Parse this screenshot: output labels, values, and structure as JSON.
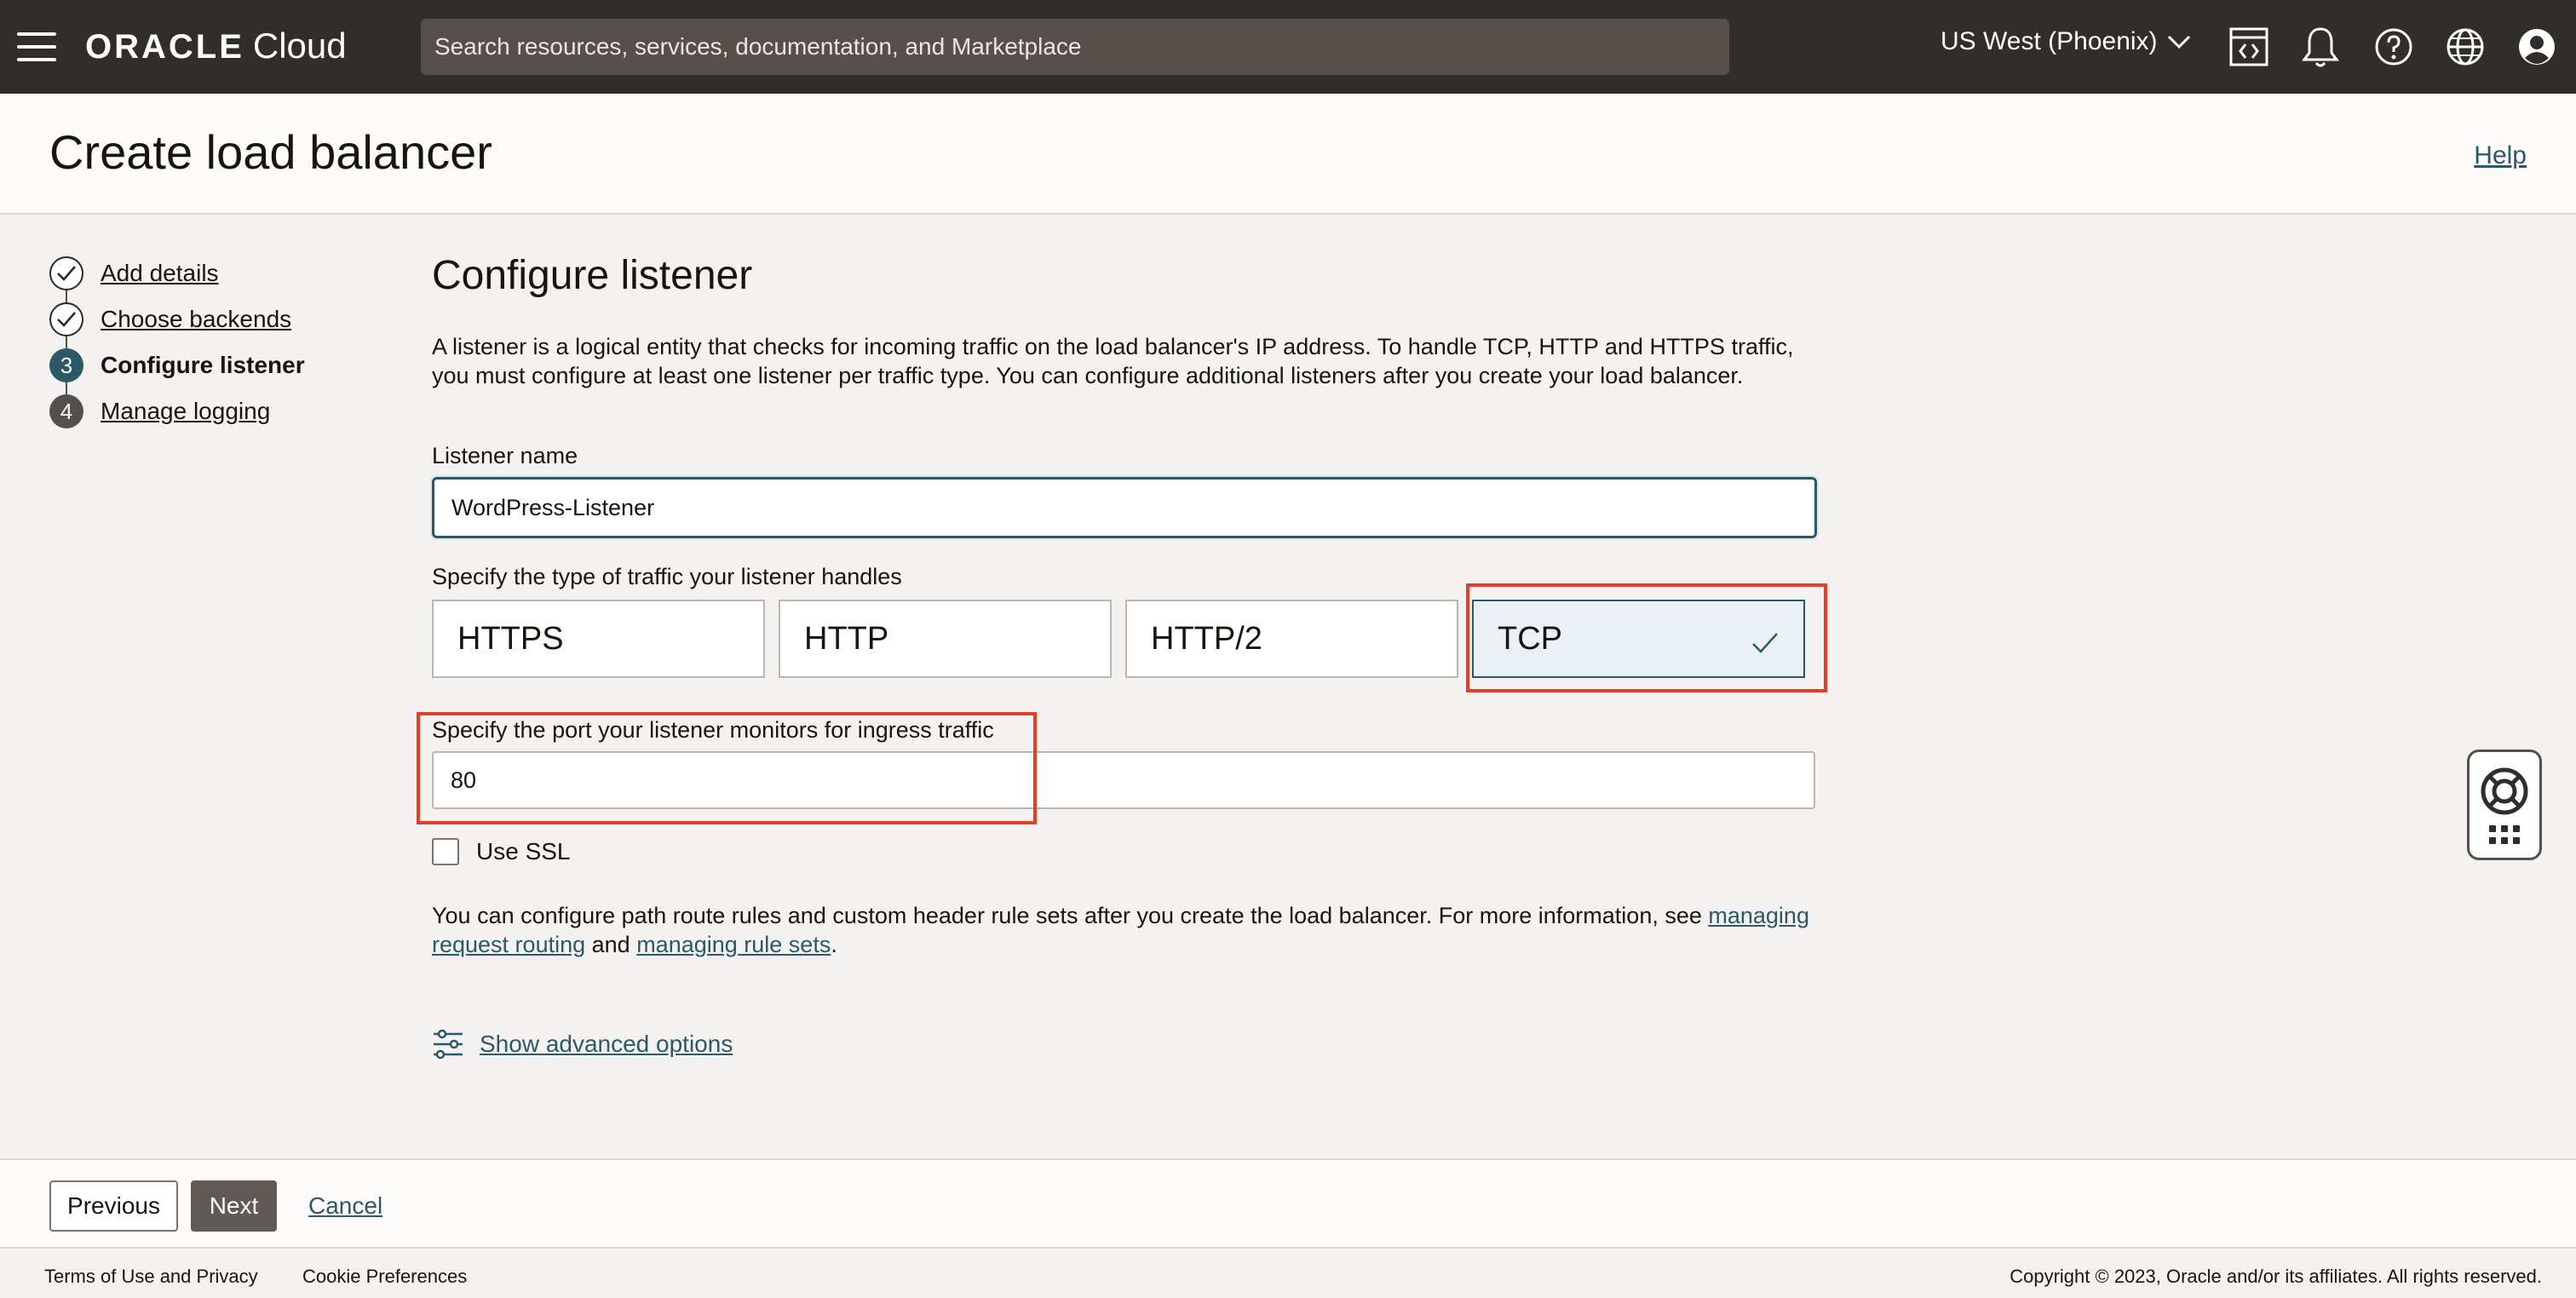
{
  "topbar": {
    "logo_brand": "ORACLE",
    "logo_product": "Cloud",
    "search_placeholder": "Search resources, services, documentation, and Marketplace",
    "region": "US West (Phoenix)",
    "icons": [
      "hamburger-menu-icon",
      "cloud-shell-icon",
      "bell-icon",
      "help-icon",
      "globe-icon",
      "user-avatar-icon"
    ]
  },
  "header": {
    "title": "Create load balancer",
    "help_label": "Help"
  },
  "steps": [
    {
      "number": "1",
      "label": "Add details",
      "status": "done"
    },
    {
      "number": "2",
      "label": "Choose backends",
      "status": "done"
    },
    {
      "number": "3",
      "label": "Configure listener",
      "status": "current"
    },
    {
      "number": "4",
      "label": "Manage logging",
      "status": "future"
    }
  ],
  "main": {
    "title": "Configure listener",
    "description": "A listener is a logical entity that checks for incoming traffic on the load balancer's IP address. To handle TCP, HTTP and HTTPS traffic, you must configure at least one listener per traffic type. You can configure additional listeners after you create your load balancer.",
    "listener_name_label": "Listener name",
    "listener_name_value": "WordPress-Listener",
    "traffic_type_label": "Specify the type of traffic your listener handles",
    "traffic_types": [
      "HTTPS",
      "HTTP",
      "HTTP/2",
      "TCP"
    ],
    "selected_traffic_type": "TCP",
    "port_label": "Specify the port your listener monitors for ingress traffic",
    "port_value": "80",
    "use_ssl_label": "Use SSL",
    "use_ssl_checked": false,
    "info_text_1": "You can configure path route rules and custom header rule sets after you create the load balancer. For more information, see ",
    "info_link_1": "managing request routing",
    "info_text_2": " and ",
    "info_link_2": "managing rule sets",
    "info_text_3": ".",
    "advanced_label": "Show advanced options"
  },
  "actions": {
    "previous": "Previous",
    "next": "Next",
    "cancel": "Cancel"
  },
  "footer": {
    "terms": "Terms of Use and Privacy",
    "cookies": "Cookie Preferences",
    "copyright": "Copyright © 2023, Oracle and/or its affiliates. All rights reserved."
  },
  "colors": {
    "topbar": "#312d2a",
    "accent": "#2c5967",
    "highlight": "#e0402a"
  }
}
